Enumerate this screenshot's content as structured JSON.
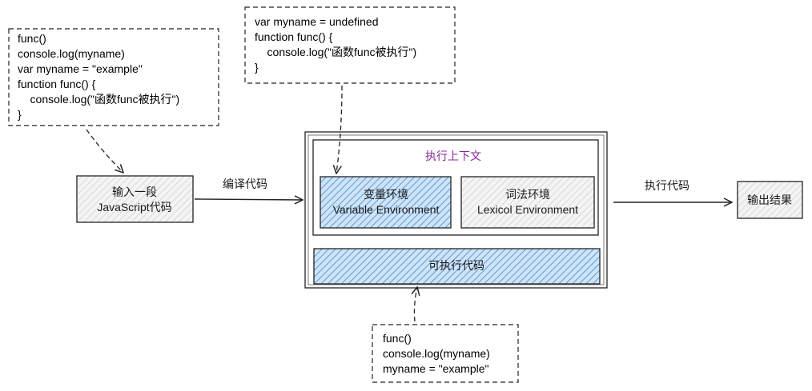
{
  "code_boxes": {
    "top_left": {
      "lines": [
        "func()",
        "console.log(myname)",
        "var myname = \"example\"",
        "function func() {",
        "    console.log(\"函数func被执行\")",
        "}"
      ]
    },
    "top_center": {
      "lines": [
        "var myname = undefined",
        "function func() {",
        "    console.log(\"函数func被执行\")",
        "}"
      ]
    },
    "bottom_center": {
      "lines": [
        "func()",
        "console.log(myname)",
        "myname = \"example\""
      ]
    }
  },
  "input_box": {
    "line1": "输入一段",
    "line2": "JavaScript代码"
  },
  "compile_label": "编译代码",
  "context": {
    "title": "执行上下文",
    "variable_env": {
      "line1": "变量环境",
      "line2": "Variable Environment"
    },
    "lexical_env": {
      "line1": "词法环境",
      "line2": "Lexicol Environment"
    },
    "executable_code": "可执行代码"
  },
  "execute_label": "执行代码",
  "output_box": {
    "label": "输出结果"
  },
  "colors": {
    "stroke": "#222222",
    "hatch_blue": "#5b9bd5",
    "fill_blue": "#a9cdf0",
    "fill_gray": "#ececec",
    "title_purple": "#8a2a9a"
  }
}
